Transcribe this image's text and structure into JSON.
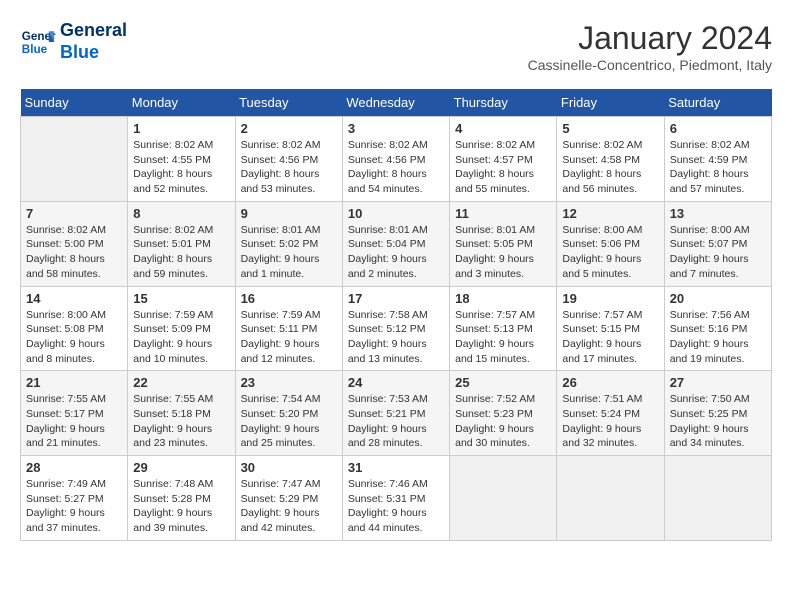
{
  "header": {
    "logo_line1": "General",
    "logo_line2": "Blue",
    "title": "January 2024",
    "subtitle": "Cassinelle-Concentrico, Piedmont, Italy"
  },
  "weekdays": [
    "Sunday",
    "Monday",
    "Tuesday",
    "Wednesday",
    "Thursday",
    "Friday",
    "Saturday"
  ],
  "weeks": [
    [
      {
        "day": "",
        "empty": true
      },
      {
        "day": "1",
        "sunrise": "8:02 AM",
        "sunset": "4:55 PM",
        "daylight": "8 hours and 52 minutes."
      },
      {
        "day": "2",
        "sunrise": "8:02 AM",
        "sunset": "4:56 PM",
        "daylight": "8 hours and 53 minutes."
      },
      {
        "day": "3",
        "sunrise": "8:02 AM",
        "sunset": "4:56 PM",
        "daylight": "8 hours and 54 minutes."
      },
      {
        "day": "4",
        "sunrise": "8:02 AM",
        "sunset": "4:57 PM",
        "daylight": "8 hours and 55 minutes."
      },
      {
        "day": "5",
        "sunrise": "8:02 AM",
        "sunset": "4:58 PM",
        "daylight": "8 hours and 56 minutes."
      },
      {
        "day": "6",
        "sunrise": "8:02 AM",
        "sunset": "4:59 PM",
        "daylight": "8 hours and 57 minutes."
      }
    ],
    [
      {
        "day": "7",
        "sunrise": "8:02 AM",
        "sunset": "5:00 PM",
        "daylight": "8 hours and 58 minutes."
      },
      {
        "day": "8",
        "sunrise": "8:02 AM",
        "sunset": "5:01 PM",
        "daylight": "8 hours and 59 minutes."
      },
      {
        "day": "9",
        "sunrise": "8:01 AM",
        "sunset": "5:02 PM",
        "daylight": "9 hours and 1 minute."
      },
      {
        "day": "10",
        "sunrise": "8:01 AM",
        "sunset": "5:04 PM",
        "daylight": "9 hours and 2 minutes."
      },
      {
        "day": "11",
        "sunrise": "8:01 AM",
        "sunset": "5:05 PM",
        "daylight": "9 hours and 3 minutes."
      },
      {
        "day": "12",
        "sunrise": "8:00 AM",
        "sunset": "5:06 PM",
        "daylight": "9 hours and 5 minutes."
      },
      {
        "day": "13",
        "sunrise": "8:00 AM",
        "sunset": "5:07 PM",
        "daylight": "9 hours and 7 minutes."
      }
    ],
    [
      {
        "day": "14",
        "sunrise": "8:00 AM",
        "sunset": "5:08 PM",
        "daylight": "9 hours and 8 minutes."
      },
      {
        "day": "15",
        "sunrise": "7:59 AM",
        "sunset": "5:09 PM",
        "daylight": "9 hours and 10 minutes."
      },
      {
        "day": "16",
        "sunrise": "7:59 AM",
        "sunset": "5:11 PM",
        "daylight": "9 hours and 12 minutes."
      },
      {
        "day": "17",
        "sunrise": "7:58 AM",
        "sunset": "5:12 PM",
        "daylight": "9 hours and 13 minutes."
      },
      {
        "day": "18",
        "sunrise": "7:57 AM",
        "sunset": "5:13 PM",
        "daylight": "9 hours and 15 minutes."
      },
      {
        "day": "19",
        "sunrise": "7:57 AM",
        "sunset": "5:15 PM",
        "daylight": "9 hours and 17 minutes."
      },
      {
        "day": "20",
        "sunrise": "7:56 AM",
        "sunset": "5:16 PM",
        "daylight": "9 hours and 19 minutes."
      }
    ],
    [
      {
        "day": "21",
        "sunrise": "7:55 AM",
        "sunset": "5:17 PM",
        "daylight": "9 hours and 21 minutes."
      },
      {
        "day": "22",
        "sunrise": "7:55 AM",
        "sunset": "5:18 PM",
        "daylight": "9 hours and 23 minutes."
      },
      {
        "day": "23",
        "sunrise": "7:54 AM",
        "sunset": "5:20 PM",
        "daylight": "9 hours and 25 minutes."
      },
      {
        "day": "24",
        "sunrise": "7:53 AM",
        "sunset": "5:21 PM",
        "daylight": "9 hours and 28 minutes."
      },
      {
        "day": "25",
        "sunrise": "7:52 AM",
        "sunset": "5:23 PM",
        "daylight": "9 hours and 30 minutes."
      },
      {
        "day": "26",
        "sunrise": "7:51 AM",
        "sunset": "5:24 PM",
        "daylight": "9 hours and 32 minutes."
      },
      {
        "day": "27",
        "sunrise": "7:50 AM",
        "sunset": "5:25 PM",
        "daylight": "9 hours and 34 minutes."
      }
    ],
    [
      {
        "day": "28",
        "sunrise": "7:49 AM",
        "sunset": "5:27 PM",
        "daylight": "9 hours and 37 minutes."
      },
      {
        "day": "29",
        "sunrise": "7:48 AM",
        "sunset": "5:28 PM",
        "daylight": "9 hours and 39 minutes."
      },
      {
        "day": "30",
        "sunrise": "7:47 AM",
        "sunset": "5:29 PM",
        "daylight": "9 hours and 42 minutes."
      },
      {
        "day": "31",
        "sunrise": "7:46 AM",
        "sunset": "5:31 PM",
        "daylight": "9 hours and 44 minutes."
      },
      {
        "day": "",
        "empty": true
      },
      {
        "day": "",
        "empty": true
      },
      {
        "day": "",
        "empty": true
      }
    ]
  ]
}
